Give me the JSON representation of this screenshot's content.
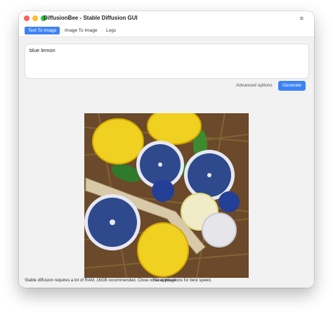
{
  "app": {
    "title": "DiffusionBee - Stable Diffusion GUI",
    "menu_icon": "hamburger-icon"
  },
  "tabs": [
    {
      "label": "Text To Image",
      "active": true
    },
    {
      "label": "Image To Image",
      "active": false
    },
    {
      "label": "Logs",
      "active": false
    }
  ],
  "prompt": {
    "value": "blue lemon"
  },
  "actions": {
    "advanced_label": "Advanced options",
    "generate_label": "Generate"
  },
  "result": {
    "image": "generated-image-blue-lemons-in-basket"
  },
  "footer": {
    "status_text": "Stable diffusion requires a lot of RAM. 16GB recommended. Close other applications for best speed.",
    "overlay_text": "Save image"
  },
  "colors": {
    "accent": "#3c82f6",
    "window_bg": "#f2f2f2"
  }
}
